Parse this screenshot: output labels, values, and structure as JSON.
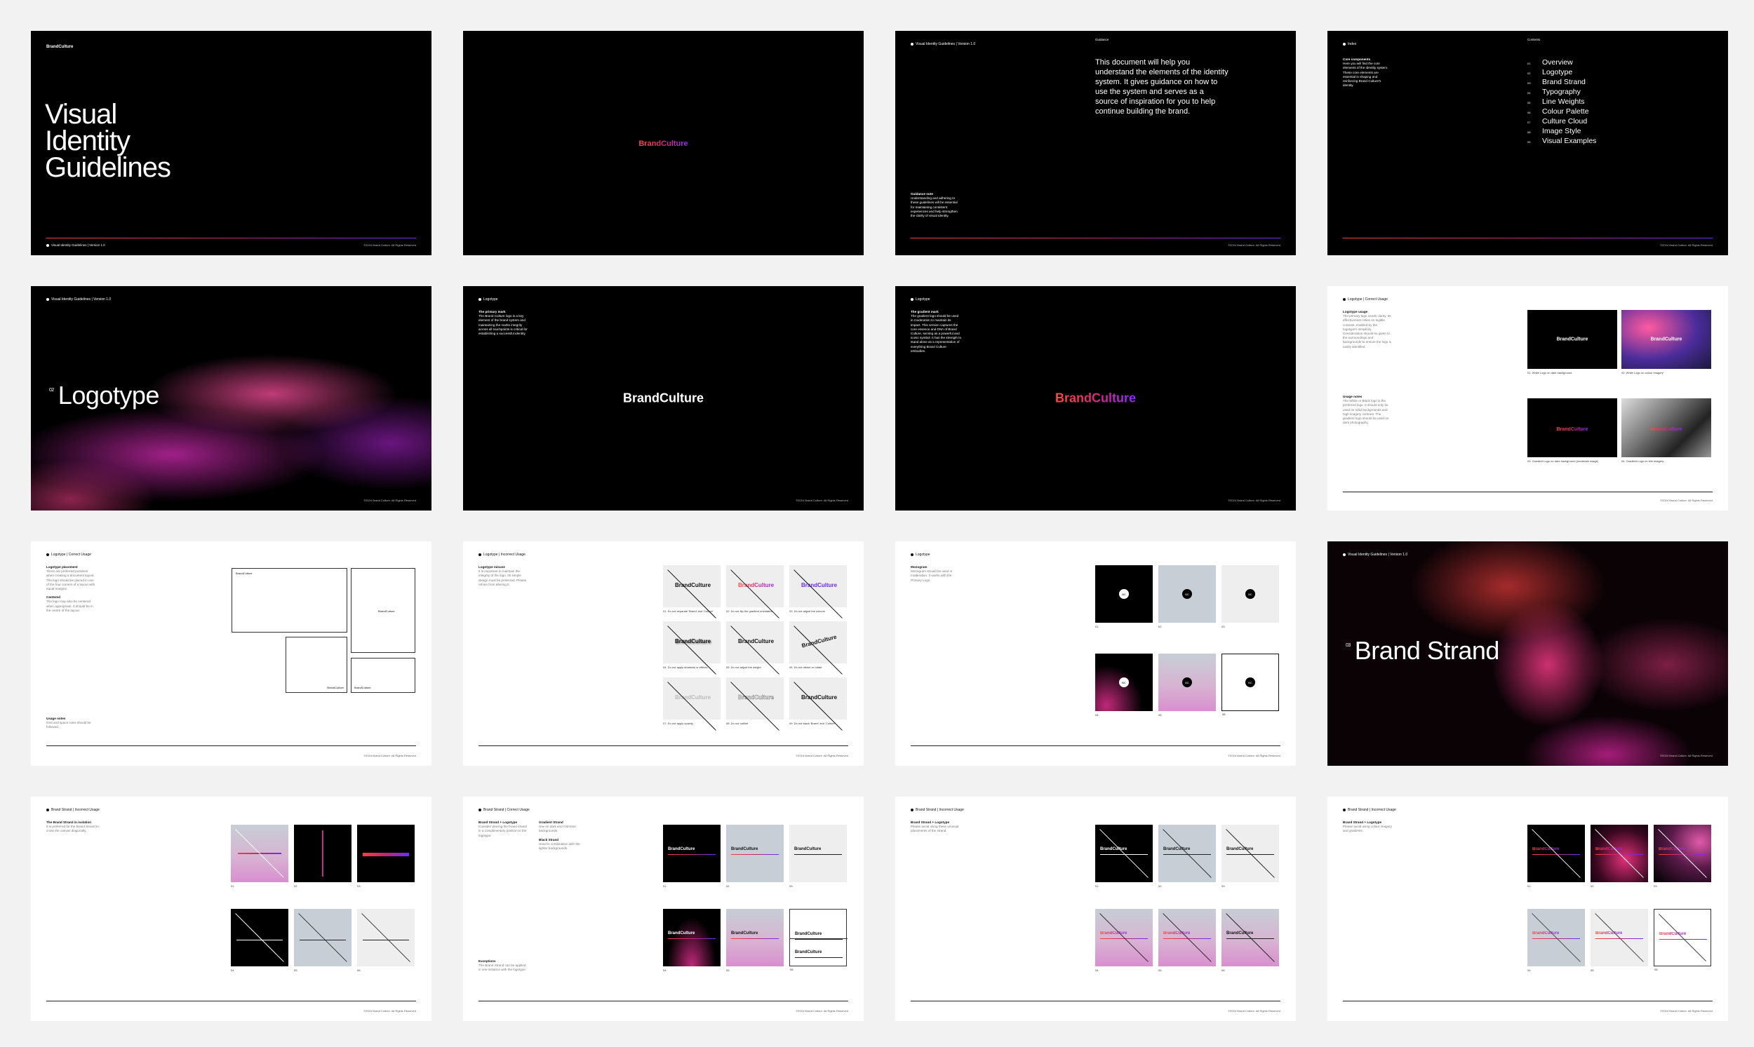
{
  "brand": "BrandCulture",
  "footer_label": "Visual Identity Guidelines | Version 1.0",
  "copyright": "©2024 Brand Culture. All Rights Reserved",
  "colors": {
    "gradient_start": "#ff3b3b",
    "gradient_mid": "#c0286e",
    "gradient_end": "#6a2cff",
    "dark": "#000000",
    "light_grey": "#c7ced6"
  },
  "s1": {
    "title_lines": [
      "Visual",
      "Identity",
      "Guidelines"
    ]
  },
  "s3": {
    "header": "Visual Identity Guidelines | Version 1.0",
    "section": "Guidance",
    "intro": "This document will help you understand the elements of the identity system. It gives guidance on how to use the system and serves as a source of inspiration for you to help continue building the brand.",
    "note_title": "Guidance note",
    "note": "Understanding and adhering to these guidelines will be essential for maintaining consistent experiences and help strengthen the clarity of visual identity."
  },
  "s4": {
    "header": "Index",
    "contents_label": "Contents",
    "side_title": "Core components",
    "side": "Here you will find the core elements of the identity system. These core elements are essential in shaping and reinforcing Brand Culture's identity.",
    "items": [
      "Overview",
      "Logotype",
      "Brand Strand",
      "Typography",
      "Line Weights",
      "Colour Palette",
      "Culture Cloud",
      "Image Style",
      "Visual Examples"
    ],
    "nums": [
      "01",
      "02",
      "03",
      "04",
      "05",
      "06",
      "07",
      "08",
      "09"
    ]
  },
  "s5": {
    "num": "02",
    "title": "Logotype"
  },
  "s6": {
    "header": "Logotype",
    "label": "The primary mark",
    "text": "The Brand Culture logo is a key element of the brand system and maintaining the marks integrity across all touchpoints is critical for establishing a successful identity."
  },
  "s7": {
    "header": "Logotype",
    "label": "The gradient mark",
    "text": "The gradient logo should be used in moderation to maintain its impact. This version captures the core essence and DNA of Brand Culture, serving as a powerful and iconic symbol. It has the strength to stand alone as a representation of everything Brand Culture embodies."
  },
  "s8": {
    "header": "Logotype | Correct Usage",
    "usage_title": "Logotype usage",
    "usage": "The primary logo needs clarity. Its effectiveness relies on legible contrast, enabled by the logotype's simplicity. Consideration should be given to the surroundings and backgrounds to ensure the logo is easily identified.",
    "notes_title": "Usage notes",
    "notes": "The White or Black logo is the preferred logo. It should only be used on solid backgrounds and high imagery contrast. The gradient logo should be used on dark photography.",
    "captions": [
      "01. White Logo on dark background",
      "02. White Logo on colour imagery",
      "03. Gradient Logo on dark background (moderate usage)",
      "04. Gradient Logo on b/w imagery"
    ]
  },
  "s9": {
    "header": "Logotype | Correct Usage",
    "placement_title": "Logotype placement",
    "placement": "There are preferred positions when creating a document layout. The logo should be placed in one of the four corners of a layout with equal margins.",
    "centered_title": "Centered",
    "centered": "The logo may also be centered when appropriate. It should be in the centre of the layout.",
    "usage_title": "Usage notes",
    "usage": "Grid and space rules should be followed.",
    "wire_label": "BrandCulture"
  },
  "s10": {
    "header": "Logotype | Incorrect Usage",
    "title": "Logotype misuse",
    "text": "It is important to maintain the integrity of the logo. Its simple design must be protected. Please refrain from altering it.",
    "captions": [
      "01. Do not separate 'Brand' and 'Culture'",
      "02. Do not flip the gradient orientation",
      "03. Do not adjust the colours",
      "04. Do not apply shadows or effects",
      "05. Do not adjust the weight",
      "06. Do not distort or rotate",
      "07. Do not apply opacity",
      "08. Do not outline",
      "09. Do not stack 'Brand' and 'Culture'"
    ]
  },
  "s11": {
    "header": "Logotype",
    "title": "Monogram",
    "text": "Monogram should be used in moderation. It works with the Primary Logo.",
    "mono": "BC",
    "captions": [
      "01.",
      "02.",
      "03.",
      "04.",
      "05.",
      "06."
    ]
  },
  "s12": {
    "header": "Visual Identity Guidelines | Version 1.0",
    "num": "03",
    "title": "Brand Strand"
  },
  "s13": {
    "header": "Brand Strand | Incorrect Usage",
    "title": "The Brand Strand in isolation",
    "text": "It is preferred for the Brand Strand to cross the canvas diagonally.",
    "captions": [
      "01.",
      "02.",
      "03.",
      "04.",
      "05.",
      "06."
    ]
  },
  "s14": {
    "header": "Brand Strand | Correct Usage",
    "col1_title": "Brand Strand + Logotype",
    "col1": "Consider placing the brand strand in a complimentary position to the logotype.",
    "col2_title": "Gradient Strand",
    "col2": "Use on dark and mid-tone backgrounds.",
    "col3_title": "Black Strand",
    "col3": "Used in combination with the lighter backgrounds.",
    "exc_title": "Exceptions",
    "exc": "The Brand Strand can be applied in one instance with the logotype.",
    "captions": [
      "01.",
      "02.",
      "03.",
      "04.",
      "05.",
      "06."
    ]
  },
  "s15": {
    "header": "Brand Strand | Incorrect Usage",
    "title": "Brand Strand + Logotype",
    "text": "Please avoid using these unusual placements of the strand.",
    "captions": [
      "01.",
      "02.",
      "03.",
      "04.",
      "05.",
      "06."
    ]
  },
  "s16": {
    "header": "Brand Strand | Incorrect Usage",
    "title": "Brand Strand + Logotype",
    "text": "Please avoid using colour imagery and gradients.",
    "captions": [
      "01.",
      "02.",
      "03.",
      "04.",
      "05.",
      "06."
    ]
  }
}
